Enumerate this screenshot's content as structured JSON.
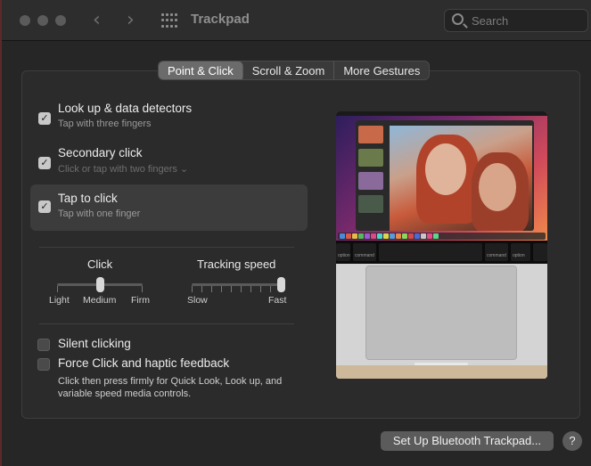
{
  "window": {
    "title": "Trackpad"
  },
  "search": {
    "placeholder": "Search"
  },
  "tabs": [
    {
      "label": "Point & Click",
      "active": true
    },
    {
      "label": "Scroll & Zoom",
      "active": false
    },
    {
      "label": "More Gestures",
      "active": false
    }
  ],
  "options": [
    {
      "title": "Look up & data detectors",
      "subtitle": "Tap with three fingers",
      "checked": true
    },
    {
      "title": "Secondary click",
      "subtitle": "Click or tap with two fingers ⌄",
      "checked": true
    },
    {
      "title": "Tap to click",
      "subtitle": "Tap with one finger",
      "checked": true,
      "selected": true
    }
  ],
  "click_slider": {
    "label": "Click",
    "scale": [
      "Light",
      "Medium",
      "Firm"
    ],
    "value": "Medium"
  },
  "speed_slider": {
    "label": "Tracking speed",
    "scale_min": "Slow",
    "scale_max": "Fast",
    "value_fraction": 1.0
  },
  "checkboxes": [
    {
      "label": "Silent clicking",
      "checked": false
    },
    {
      "label": "Force Click and haptic feedback",
      "checked": false
    }
  ],
  "force_click_help": "Click then press firmly for Quick Look, Look up, and variable speed media controls.",
  "keyboard_keys": {
    "opt_left": "option",
    "cmd_left": "command",
    "cmd_right": "command",
    "opt_right": "option"
  },
  "footer": {
    "bluetooth_button": "Set Up Bluetooth Trackpad...",
    "help_button": "?"
  },
  "colors": {
    "accent_checkbox": "#c8c8c8",
    "panel_bg": "#2b2b2b",
    "selected_row": "#3c3c3c"
  }
}
